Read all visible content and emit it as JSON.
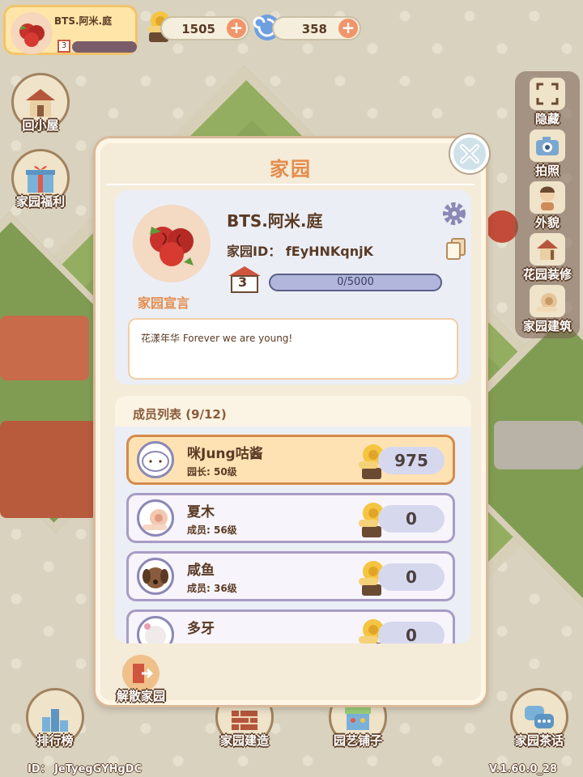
{
  "player": {
    "name": "BTS.阿米.庭",
    "level": "3"
  },
  "currency": {
    "gold": "1505",
    "gems": "358",
    "plus_symbol": "+"
  },
  "left_menu": {
    "home_label": "回小屋",
    "welfare_label": "家园福利"
  },
  "right_menu": {
    "hide_label": "隐藏",
    "photo_label": "拍照",
    "appearance_label": "外貌",
    "decor_label": "花园装修",
    "build_label": "家园建筑"
  },
  "bottom_bar": {
    "ranking_label": "排行榜",
    "garden_build_label": "家园建造",
    "shop_label": "园艺铺子",
    "chat_label": "家园茶话"
  },
  "footer": {
    "player_id": "ID： JeTyegGYHgDC",
    "version": "V.1.60.0_28"
  },
  "modal": {
    "title": "家园",
    "garden_name": "BTS.阿米.庭",
    "garden_id": "家园ID： fEyHNKqnjK",
    "garden_level": "3",
    "exp_text": "0/5000",
    "exp_progress": 0,
    "declaration_label": "家园宣言",
    "motto": "花漾年华 Forever we are young!",
    "members_header": "成员列表 (9/12)",
    "members": [
      {
        "name": "咪Jung咕酱",
        "role": "园长: 50级",
        "score": "975"
      },
      {
        "name": "夏木",
        "role": "成员: 56级",
        "score": "0"
      },
      {
        "name": "咸鱼",
        "role": "成员: 36级",
        "score": "0"
      },
      {
        "name": "多牙",
        "role": "",
        "score": "0"
      }
    ],
    "disband_label": "解散家园"
  },
  "colors": {
    "accent": "#e48c4c",
    "leader_row": "#ffe2b4",
    "member_border": "#a89cc4"
  }
}
